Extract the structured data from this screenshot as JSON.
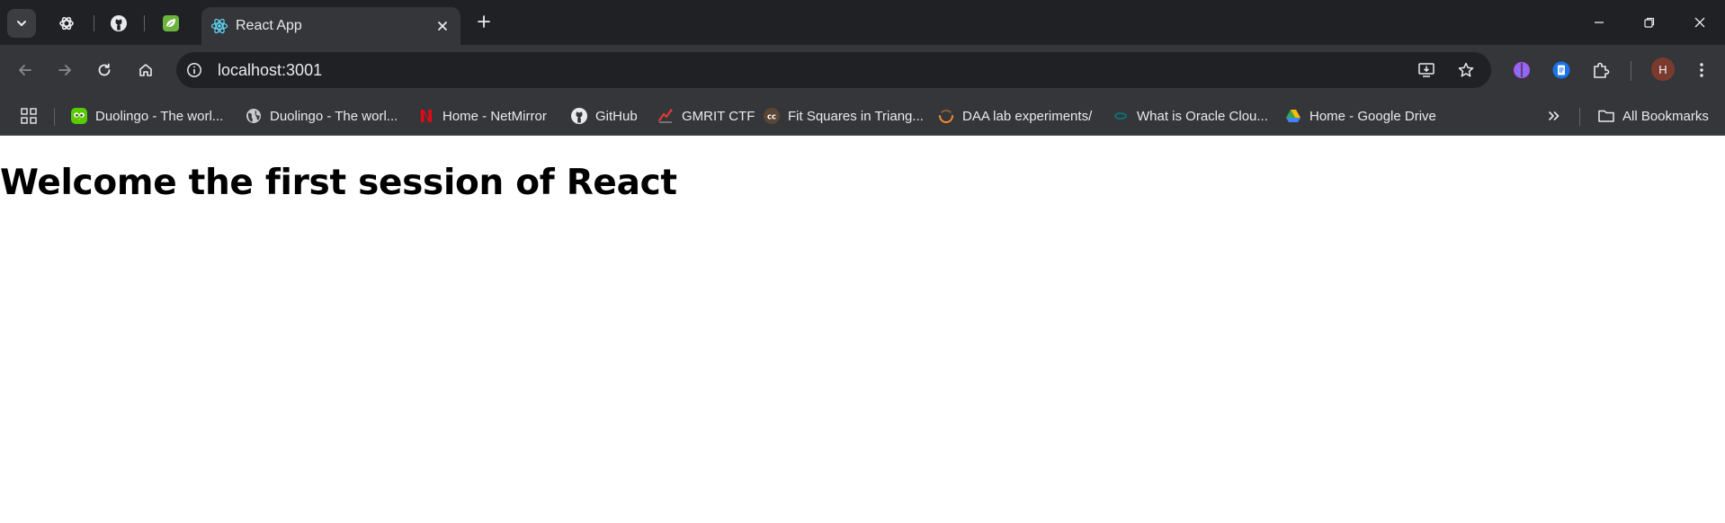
{
  "colors": {
    "tabstrip_bg": "#202124",
    "toolbar_bg": "#35363a",
    "omnibox_bg": "#202124",
    "text_light": "#e8eaed",
    "page_bg": "#ffffff"
  },
  "tabs": {
    "pinned": [
      {
        "icon": "chatgpt-icon"
      },
      {
        "icon": "github-icon"
      },
      {
        "icon": "spring-leaf-icon"
      }
    ],
    "active": {
      "title": "React App",
      "icon": "react-icon"
    }
  },
  "omnibox": {
    "url": "localhost:3001"
  },
  "profile": {
    "initial": "H"
  },
  "bookmarks": {
    "items": [
      {
        "label": "Duolingo - The worl...",
        "icon": "duolingo-icon"
      },
      {
        "label": "Duolingo - The worl...",
        "icon": "globe-icon"
      },
      {
        "label": "Home - NetMirror",
        "icon": "netmirror-icon"
      },
      {
        "label": "GitHub",
        "icon": "github-icon"
      },
      {
        "label": "GMRIT CTF",
        "icon": "ctf-icon"
      },
      {
        "label": "Fit Squares in Triang...",
        "icon": "cc-icon"
      },
      {
        "label": "DAA lab experiments/",
        "icon": "loader-icon"
      },
      {
        "label": "What is Oracle Clou...",
        "icon": "oracle-cloud-icon"
      },
      {
        "label": "Home - Google Drive",
        "icon": "google-drive-icon"
      }
    ],
    "all_label": "All Bookmarks"
  },
  "page": {
    "heading": "Welcome the first session of React"
  }
}
